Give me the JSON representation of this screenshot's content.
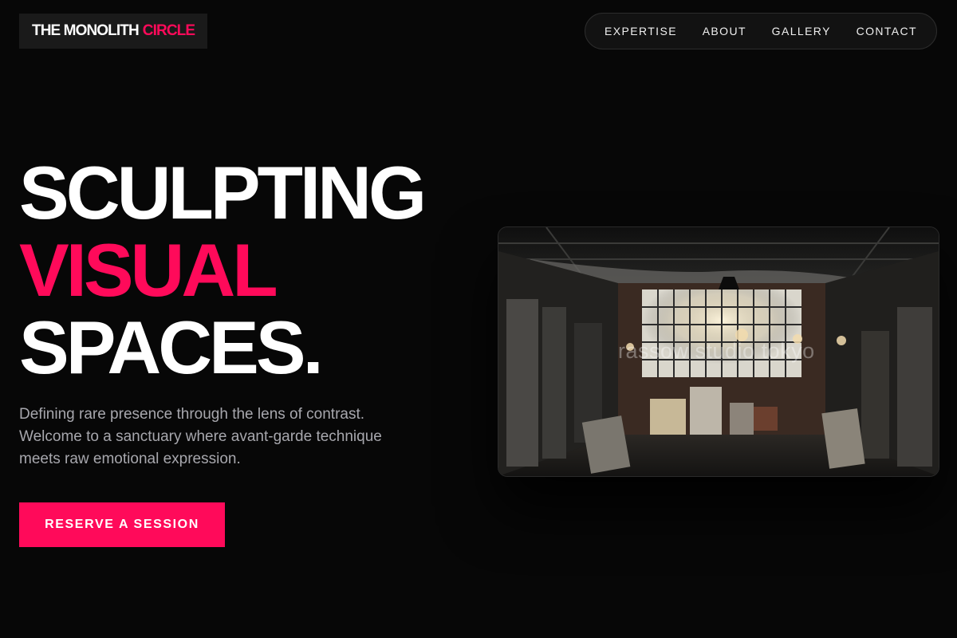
{
  "brand": {
    "name_main": "THE MONOLITH",
    "name_accent": "CIRCLE"
  },
  "nav": {
    "items": [
      "EXPERTISE",
      "ABOUT",
      "GALLERY",
      "CONTACT"
    ]
  },
  "hero": {
    "headline": [
      "SCULPTING",
      "VISUAL",
      "SPACES."
    ],
    "description": "Defining rare presence through the lens of contrast. Welcome to a sanctuary where avant-garde technique meets raw emotional expression.",
    "cta_label": "RESERVE A SESSION",
    "image_watermark": "rassow studio tokyo"
  },
  "colors": {
    "background": "#070707",
    "accent": "#ff0a5a",
    "text": "#ffffff",
    "muted_text": "#a7a7ad"
  }
}
